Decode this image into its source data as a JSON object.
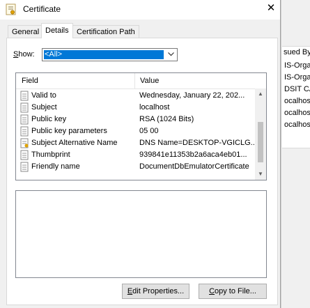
{
  "window": {
    "title": "Certificate",
    "close_glyph": "✕"
  },
  "tabs": [
    {
      "label": "General"
    },
    {
      "label": "Details"
    },
    {
      "label": "Certification Path"
    }
  ],
  "show": {
    "label_accel": "S",
    "label_rest": "how:",
    "selected": "<All>"
  },
  "list": {
    "columns": {
      "field": "Field",
      "value": "Value"
    },
    "rows": [
      {
        "field": "Valid to",
        "value": "Wednesday, January 22, 202..."
      },
      {
        "field": "Subject",
        "value": "localhost"
      },
      {
        "field": "Public key",
        "value": "RSA (1024 Bits)"
      },
      {
        "field": "Public key parameters",
        "value": "05 00"
      },
      {
        "field": "Subject Alternative Name",
        "value": "DNS Name=DESKTOP-VGICLG..."
      },
      {
        "field": "Thumbprint",
        "value": "939841e11353b2a6aca4eb01..."
      },
      {
        "field": "Friendly name",
        "value": "DocumentDbEmulatorCertificate"
      }
    ]
  },
  "buttons": {
    "edit_accel": "E",
    "edit_rest": "dit Properties...",
    "copy_accel": "C",
    "copy_rest": "opy to File..."
  },
  "background": {
    "header": "sued By",
    "rows": [
      "IS-Orga",
      "IS-Orga",
      "DSIT CA",
      "ocalhost",
      "ocalhost",
      "ocalhost"
    ]
  },
  "colors": {
    "selection": "#0078d7",
    "dialog_bg": "#f0f0f0"
  }
}
